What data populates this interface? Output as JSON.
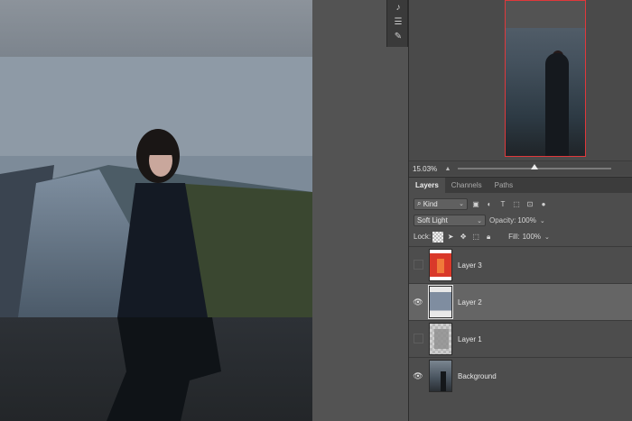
{
  "canvas": {
    "alt_subject": "woman-on-misty-road-photo"
  },
  "toolbar": {
    "tools": [
      {
        "icon": "brush-stack-icon",
        "glyph": "♪"
      },
      {
        "icon": "adjust-sliders-icon",
        "glyph": "☰"
      },
      {
        "icon": "brush-settings-icon",
        "glyph": "✎"
      }
    ]
  },
  "navigator": {
    "zoom": "15.03%",
    "zoom_fraction": 0.5
  },
  "panel_tabs": [
    "Layers",
    "Channels",
    "Paths"
  ],
  "layers_panel": {
    "filter_kind": "Kind",
    "blend_mode": "Soft Light",
    "opacity_label": "Opacity:",
    "opacity_value": "100%",
    "lock_label": "Lock:",
    "fill_label": "Fill:",
    "fill_value": "100%"
  },
  "layers": [
    {
      "name": "Layer 3",
      "visible": false
    },
    {
      "name": "Layer 2",
      "visible": true,
      "selected": true
    },
    {
      "name": "Layer 1",
      "visible": false
    },
    {
      "name": "Background",
      "visible": true
    }
  ],
  "colors": {
    "navigator_frame": "#e0383b",
    "selected_row": "#656565"
  }
}
